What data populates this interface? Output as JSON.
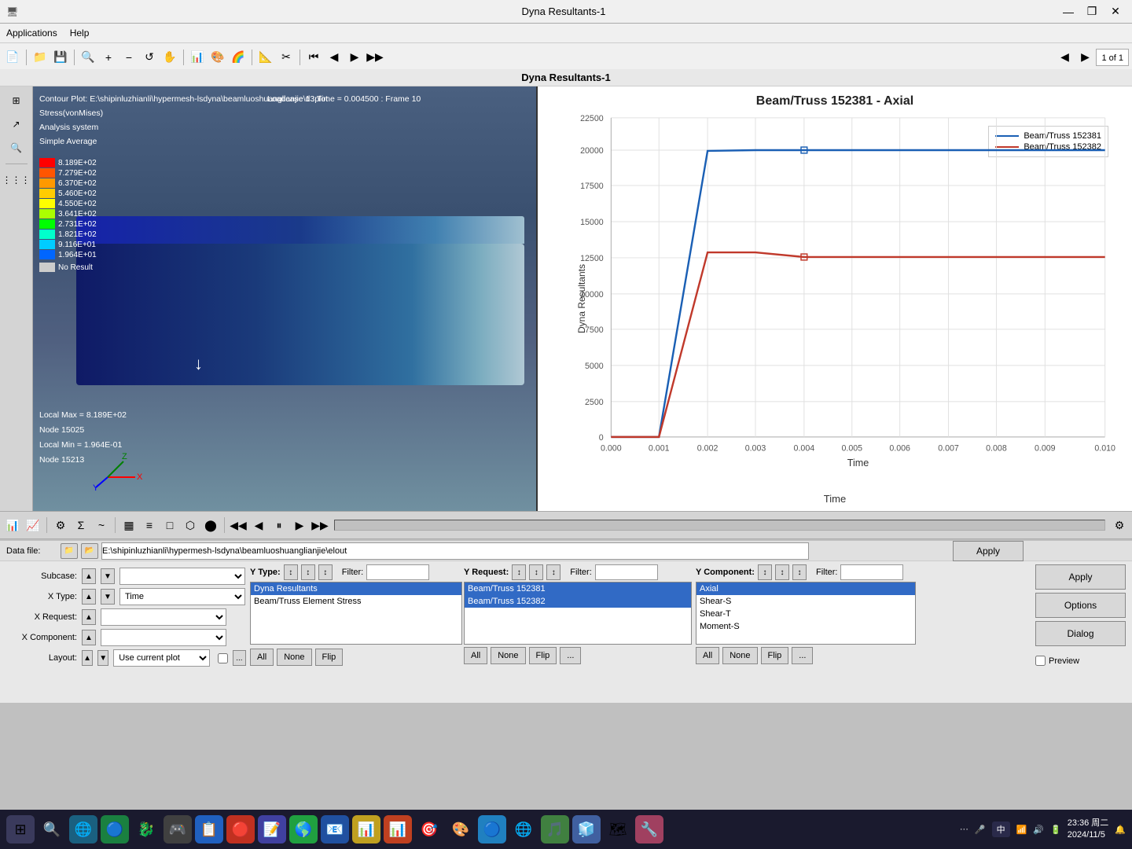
{
  "window": {
    "title": "Dyna Resultants-1",
    "minimize_btn": "—",
    "maximize_btn": "❐",
    "close_btn": "✕",
    "page_indicator": "1 of 1"
  },
  "menu": {
    "applications": "Applications",
    "help": "Help"
  },
  "app_title": "Dyna  Resultants-1",
  "viewport": {
    "contour_line1": "Contour Plot: E:\\shipinluzhianli\\hypermesh-lsdyna\\beamluoshuanglianjie\\d3plot",
    "contour_line2": "Stress(vonMises)",
    "contour_line3": "Loadcase 1 : Time = 0.004500 : Frame 10",
    "contour_line4": "Analysis system",
    "contour_line5": "Simple Average",
    "legend_values": [
      "8.189E+02",
      "7.279E+02",
      "6.370E+02",
      "5.460E+02",
      "4.550E+02",
      "3.641E+02",
      "2.731E+02",
      "1.821E+02",
      "9.116E+01",
      "1.964E+01",
      "No Result"
    ],
    "local_max_label": "Local Max = 8.189E+02",
    "node_max": "Node 15025",
    "local_min_label": "Local Min = 1.964E-01",
    "node_min": "Node 15213"
  },
  "chart": {
    "title": "Beam/Truss 152381 - Axial",
    "legend": [
      {
        "label": "Beam/Truss 152381",
        "color": "#1a5fb4"
      },
      {
        "label": "Beam/Truss 152382",
        "color": "#c0392b"
      }
    ],
    "y_label": "Dyna Resultants",
    "x_label": "Time",
    "y_ticks": [
      "0",
      "2500",
      "5000",
      "7500",
      "10000",
      "12500",
      "15000",
      "17500",
      "20000",
      "22500"
    ],
    "x_ticks": [
      "0.000",
      "0.001",
      "0.002",
      "0.003",
      "0.004",
      "0.005",
      "0.006",
      "0.007",
      "0.008",
      "0.009",
      "0.010"
    ]
  },
  "bottom_toolbar": {
    "buttons": [
      "📊",
      "📈",
      "⚙",
      "∑",
      "~",
      "▦",
      "≡",
      "□",
      "⬡",
      "⬤",
      "◀",
      "⏪",
      "⏸",
      "▶",
      "⏩",
      "⚙"
    ]
  },
  "data_file": {
    "label": "Data file:",
    "path": "E:\\shipinluzhianli\\hypermesh-lsdyna\\beamluoshuanglianjie\\elout"
  },
  "subcase": {
    "label": "Subcase:",
    "value": ""
  },
  "x_type": {
    "label": "X Type:",
    "value": "Time"
  },
  "x_request": {
    "label": "X Request:"
  },
  "x_component": {
    "label": "X Component:"
  },
  "y_type": {
    "label": "Y Type:",
    "filter_label": "Filter:"
  },
  "y_type_items": [
    {
      "label": "Dyna Resultants",
      "selected": true
    },
    {
      "label": "Beam/Truss Element Stress",
      "selected": false
    }
  ],
  "y_request": {
    "label": "Y Request:",
    "filter_label": "Filter:"
  },
  "y_request_items": [
    {
      "label": "Beam/Truss 152381",
      "selected": true
    },
    {
      "label": "Beam/Truss 152382",
      "selected": true
    }
  ],
  "y_component": {
    "label": "Y Component:",
    "filter_label": "Filter:"
  },
  "y_component_items": [
    {
      "label": "Axial",
      "selected": true
    },
    {
      "label": "Shear-S",
      "selected": false
    },
    {
      "label": "Shear-T",
      "selected": false
    },
    {
      "label": "Moment-S",
      "selected": false
    }
  ],
  "layout": {
    "label": "Layout:",
    "value": "Use current plot"
  },
  "buttons": {
    "apply": "Apply",
    "options": "Options",
    "dialog": "Dialog",
    "all": "All",
    "none": "None",
    "flip": "Flip",
    "more": "..."
  },
  "preview": {
    "label": "Preview",
    "checked": false
  },
  "taskbar": {
    "time": "23:36 周二",
    "date": "2024/11/5",
    "language": "中",
    "icons": [
      "🌐",
      "🔵",
      "🐉",
      "🎮",
      "📋",
      "🔴",
      "📝",
      "🌎",
      "📧",
      "📊",
      "📊",
      "🎯",
      "🎨",
      "🔵",
      "🌐",
      "🎵",
      "🧊",
      "🗺",
      "🔧"
    ]
  }
}
